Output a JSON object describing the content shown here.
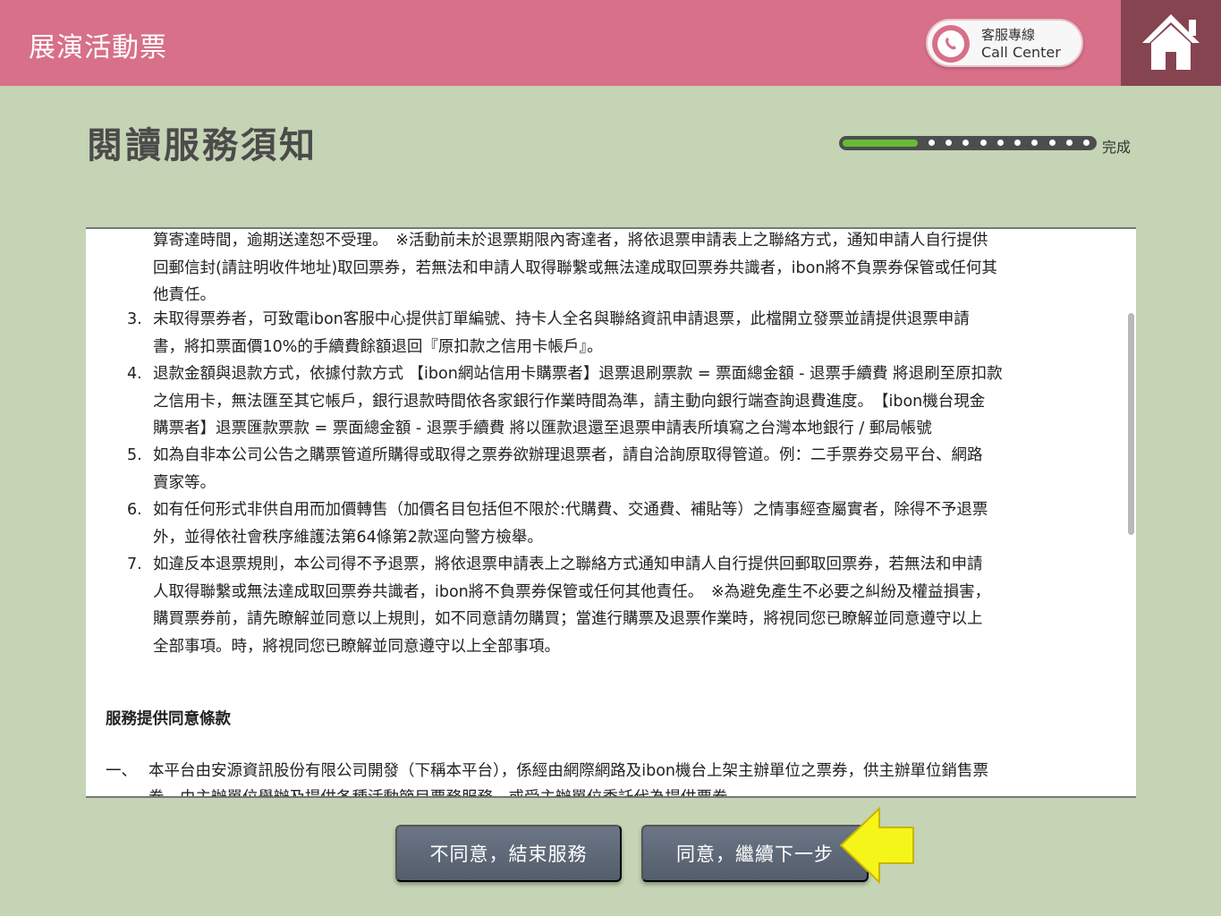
{
  "header": {
    "title": "展演活動票",
    "call_center_zh": "客服專線",
    "call_center_en": "Call Center"
  },
  "page": {
    "title": "閱讀服務須知",
    "progress_label": "完成",
    "progress_value": 0.3
  },
  "notice": {
    "top_fragment": "算寄達時間，逾期送達恕不受理。　※活動前未於退票期限內寄達者，將依退票申請表上之聯絡方式，通知申請人自行提供\n回郵信封(請註明收件地址)取回票券，若無法和申請人取得聯繫或無法達成取回票券共識者，ibon將不負票券保管或任何其\n他責任。",
    "items": [
      {
        "num": "3.",
        "text": "未取得票券者，可致電ibon客服中心提供訂單編號、持卡人全名與聯絡資訊申請退票，此檔開立發票並請提供退票申請\n書，將扣票面價10%的手續費餘額退回『原扣款之信用卡帳戶』。"
      },
      {
        "num": "4.",
        "text": "退款金額與退款方式，依據付款方式 【ibon網站信用卡購票者】退票退刷票款 = 票面總金額 - 退票手續費 將退刷至原扣款\n之信用卡，無法匯至其它帳戶，銀行退款時間依各家銀行作業時間為準，請主動向銀行端查詢退費進度。　【ibon機台現金\n購票者】退票匯款票款 = 票面總金額 - 退票手續費 將以匯款退還至退票申請表所填寫之台灣本地銀行 / 郵局帳號"
      },
      {
        "num": "5.",
        "text": "如為自非本公司公告之購票管道所購得或取得之票券欲辦理退票者，請自洽詢原取得管道。例：二手票券交易平台、網路\n賣家等。"
      },
      {
        "num": "6.",
        "text": "如有任何形式非供自用而加價轉售（加價名目包括但不限於:代購費、交通費、補貼等）之情事經查屬實者，除得不予退票\n外，並得依社會秩序維護法第64條第2款逕向警方檢舉。"
      },
      {
        "num": "7.",
        "text": "如違反本退票規則，本公司得不予退票，將依退票申請表上之聯絡方式通知申請人自行提供回郵取回票券，若無法和申請\n人取得聯繫或無法達成取回票券共識者，ibon將不負票券保管或任何其他責任。　※為避免產生不必要之糾紛及權益損害，\n購買票券前，請先瞭解並同意以上規則，如不同意請勿購買；當進行購票及退票作業時，將視同您已瞭解並同意遵守以上\n全部事項。時，將視同您已瞭解並同意遵守以上全部事項。"
      }
    ],
    "section_heading": "服務提供同意條款",
    "clause_num": "一、",
    "clause_text": "本平台由安源資訊股份有限公司開發（下稱本平台），係經由網際網路及ibon機台上架主辦單位之票券，供主辦單位銷售票\n券、由主辦單位舉辦及提供各種活動節目票務服務，或受主辦單位委託代為提供票券。"
  },
  "buttons": {
    "disagree": "不同意，結束服務",
    "agree": "同意，繼續下一步"
  },
  "colors": {
    "header": "#d77088",
    "home": "#854450",
    "background": "#c4d4b4",
    "progress_fill": "#66bc36",
    "button": "#5e6878",
    "arrow": "#f5f51a"
  }
}
